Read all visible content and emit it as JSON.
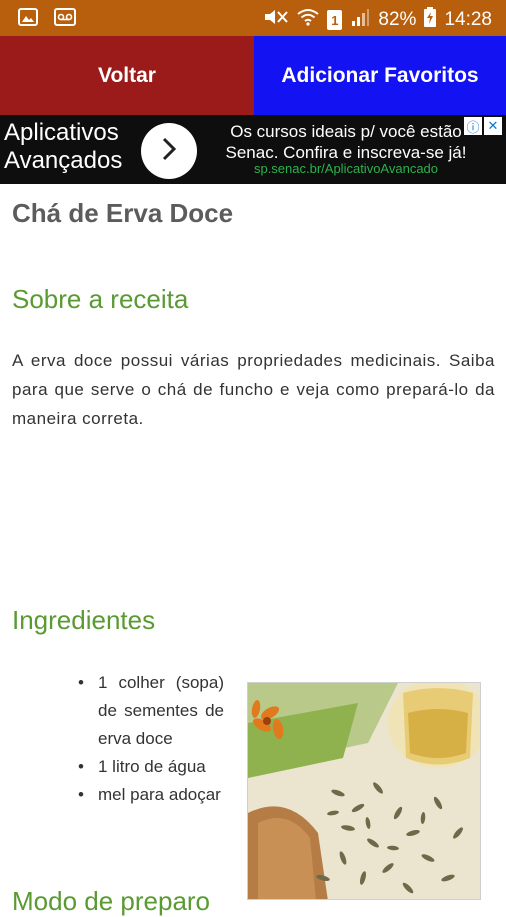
{
  "status_bar": {
    "battery": "82%",
    "time": "14:28",
    "sim_badge": "1"
  },
  "action_bar": {
    "back_label": "Voltar",
    "favorite_label": "Adicionar Favoritos",
    "back_color": "#9b1b1b",
    "favorite_color": "#1212f2"
  },
  "ad": {
    "title_line1": "Aplicativos",
    "title_line2": "Avançados",
    "text_line1": "Os cursos ideais p/ você estão",
    "text_line2": "Senac. Confira e inscreva-se já!",
    "url": "sp.senac.br/AplicativoAvancado"
  },
  "recipe": {
    "title": "Chá de Erva Doce",
    "about_heading": "Sobre a receita",
    "about_text": "A erva doce possui várias propriedades medicinais. Saiba para que serve o chá de funcho e veja como prepará-lo da maneira correta.",
    "ingredients_heading": "Ingredientes",
    "ingredients": [
      "1 colher (sopa) de sementes de erva doce",
      "1 litro de água",
      "mel para adoçar"
    ],
    "next_heading_partial": "Modo de preparo"
  },
  "colors": {
    "status_bar": "#b85f0d",
    "heading_green": "#5a9a32"
  }
}
